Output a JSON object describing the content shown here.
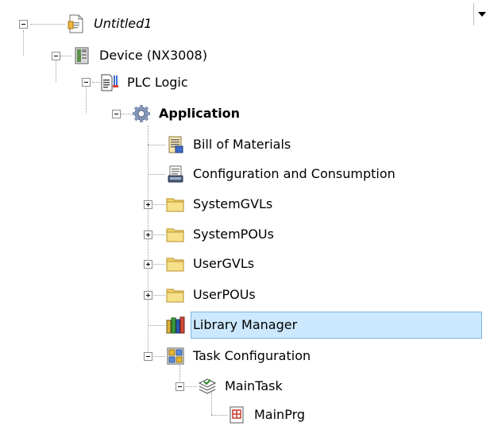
{
  "tree": {
    "project": {
      "label": "Untitled1",
      "icon": "project-file-icon"
    },
    "device": {
      "label": "Device (NX3008)",
      "icon": "device-icon"
    },
    "plc_logic": {
      "label": "PLC Logic",
      "icon": "plc-logic-icon"
    },
    "application": {
      "label": "Application",
      "icon": "gear-icon"
    },
    "bill_of_materials": {
      "label": "Bill of Materials",
      "icon": "bill-of-materials-icon"
    },
    "config_consumption": {
      "label": "Configuration and Consumption",
      "icon": "configuration-icon"
    },
    "system_gvls": {
      "label": "SystemGVLs",
      "icon": "folder-icon"
    },
    "system_pous": {
      "label": "SystemPOUs",
      "icon": "folder-icon"
    },
    "user_gvls": {
      "label": "UserGVLs",
      "icon": "folder-icon"
    },
    "user_pous": {
      "label": "UserPOUs",
      "icon": "folder-icon"
    },
    "library_manager": {
      "label": "Library Manager",
      "icon": "library-books-icon",
      "selected": true
    },
    "task_configuration": {
      "label": "Task Configuration",
      "icon": "task-configuration-icon"
    },
    "main_task": {
      "label": "MainTask",
      "icon": "task-stack-icon"
    },
    "main_prg": {
      "label": "MainPrg",
      "icon": "program-icon"
    }
  },
  "colors": {
    "selection_bg": "#cce8ff",
    "selection_border": "#7fb4dc",
    "folder": "#f2d36b"
  }
}
